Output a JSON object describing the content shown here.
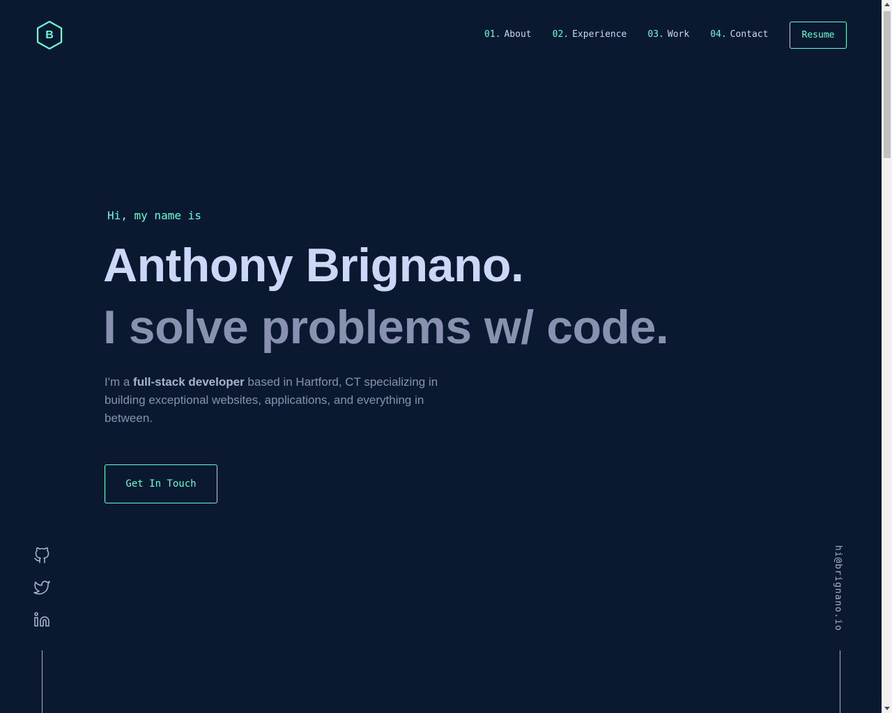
{
  "header": {
    "logo_letter": "B",
    "nav": [
      {
        "num": "01.",
        "label": "About"
      },
      {
        "num": "02.",
        "label": "Experience"
      },
      {
        "num": "03.",
        "label": "Work"
      },
      {
        "num": "04.",
        "label": "Contact"
      }
    ],
    "resume_label": "Resume"
  },
  "hero": {
    "greeting": "Hi, my name is",
    "name": "Anthony Brignano.",
    "tagline": "I solve problems w/ code.",
    "intro_prefix": "I'm a ",
    "intro_bold": "full-stack developer",
    "intro_suffix": " based in Hartford, CT specializing in building exceptional websites, applications, and everything in between.",
    "cta_label": "Get In Touch"
  },
  "social": [
    {
      "icon": "github-icon"
    },
    {
      "icon": "twitter-icon"
    },
    {
      "icon": "linkedin-icon"
    }
  ],
  "email": "hi@brignano.io",
  "colors": {
    "background": "#0a192f",
    "accent": "#64ffda",
    "heading": "#ccd6f6",
    "text": "#8892b0"
  }
}
